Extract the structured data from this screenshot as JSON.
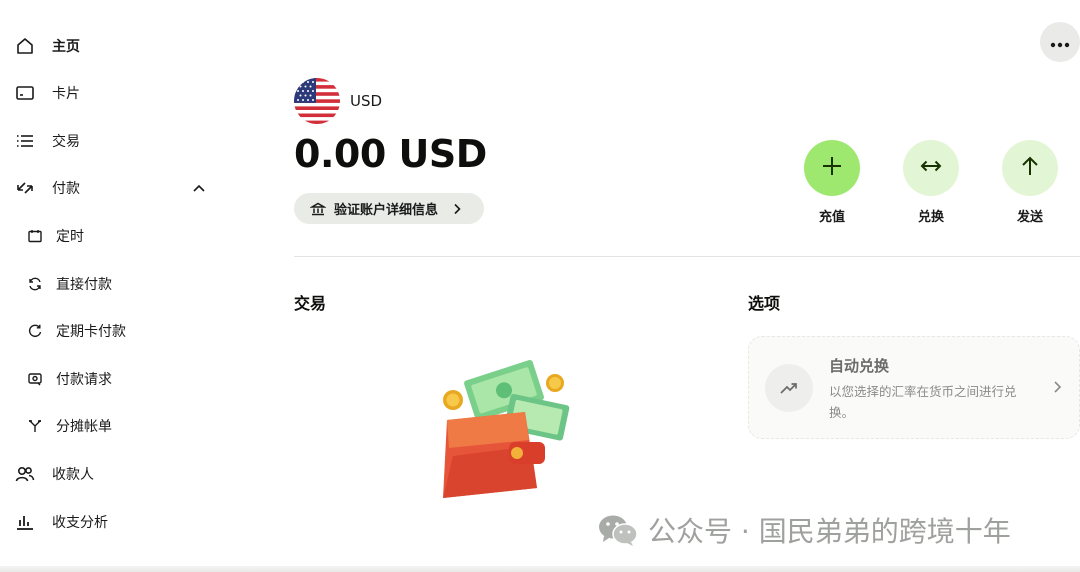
{
  "sidebar": {
    "items": [
      {
        "label": "主页",
        "icon": "home-icon",
        "active": true
      },
      {
        "label": "卡片",
        "icon": "card-icon"
      },
      {
        "label": "交易",
        "icon": "list-icon"
      },
      {
        "label": "付款",
        "icon": "transfer-arrows-icon",
        "expanded": true
      },
      {
        "label": "收款人",
        "icon": "recipients-icon"
      },
      {
        "label": "收支分析",
        "icon": "bar-chart-icon"
      }
    ],
    "payment_sub_items": [
      {
        "label": "定时",
        "icon": "calendar-icon"
      },
      {
        "label": "直接付款",
        "icon": "refresh-icon"
      },
      {
        "label": "定期卡付款",
        "icon": "recurring-icon"
      },
      {
        "label": "付款请求",
        "icon": "request-icon"
      },
      {
        "label": "分摊帐单",
        "icon": "split-icon"
      }
    ]
  },
  "account": {
    "currency_code": "USD",
    "balance": "0.00 USD",
    "verify_label": "验证账户详细信息"
  },
  "actions": [
    {
      "label": "充值",
      "icon": "plus-icon",
      "color": "#9fe870"
    },
    {
      "label": "兑换",
      "icon": "swap-icon",
      "color": "#e2f6d5"
    },
    {
      "label": "发送",
      "icon": "arrow-up-icon",
      "color": "#e2f6d5"
    }
  ],
  "sections": {
    "transactions_title": "交易",
    "options_title": "选项"
  },
  "option_card": {
    "title": "自动兑换",
    "description": "以您选择的汇率在货币之间进行兑换。"
  },
  "watermark": {
    "text": "公众号 · 国民弟弟的跨境十年"
  },
  "colors": {
    "accent_green": "#9fe870",
    "light_green": "#e2f6d5",
    "text": "#0e0f0c"
  }
}
